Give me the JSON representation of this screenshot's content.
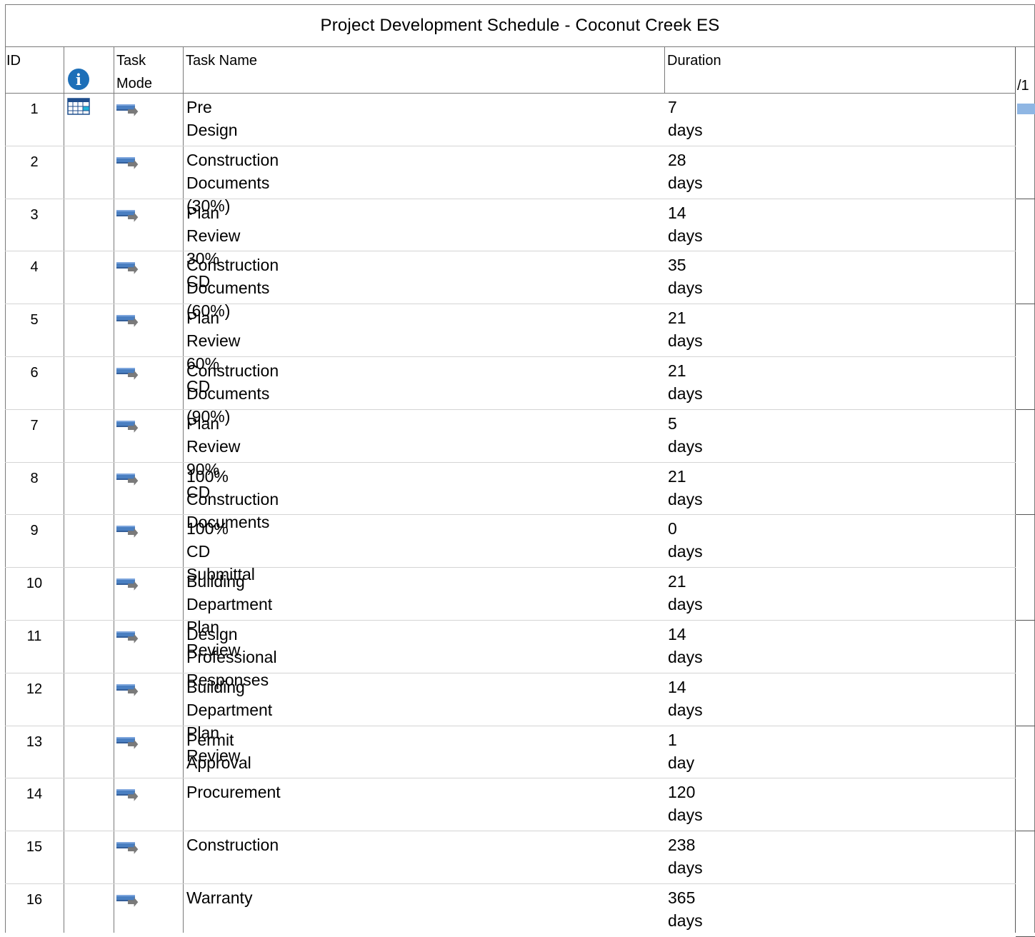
{
  "title": "Project Development Schedule - Coconut Creek ES",
  "columns": {
    "id": "ID",
    "indicators_icon": "info-icon",
    "task_mode_line1": "Task",
    "task_mode_line2": "Mode",
    "task_name": "Task Name",
    "duration": "Duration"
  },
  "gantt": {
    "timescale_label": "/1",
    "bar_color": "#8fb6e3"
  },
  "icons": {
    "info": "info-icon",
    "calendar": "calendar-icon",
    "task_mode": "auto-scheduled-task-icon"
  },
  "colors": {
    "info_icon": "#1d6fb8",
    "task_icon": "#4a7fc1"
  },
  "tasks": [
    {
      "id": "1",
      "name": "Pre Design",
      "duration": "7 days",
      "indicator": "calendar-icon"
    },
    {
      "id": "2",
      "name": "Construction Documents (30%)",
      "duration": "28 days"
    },
    {
      "id": "3",
      "name": "Plan Review 30% CD",
      "duration": "14 days"
    },
    {
      "id": "4",
      "name": "Construction Documents (60%)",
      "duration": "35 days"
    },
    {
      "id": "5",
      "name": "Plan Review 60% CD",
      "duration": "21 days"
    },
    {
      "id": "6",
      "name": "Construction Documents (90%)",
      "duration": "21 days"
    },
    {
      "id": "7",
      "name": "Plan Review 90% CD",
      "duration": "5 days"
    },
    {
      "id": "8",
      "name": "100% Construction Documents",
      "duration": "21 days"
    },
    {
      "id": "9",
      "name": "100% CD Submittal",
      "duration": "0 days"
    },
    {
      "id": "10",
      "name": "Building Department Plan Review",
      "duration": "21 days"
    },
    {
      "id": "11",
      "name": "Design Professional Responses",
      "duration": "14 days"
    },
    {
      "id": "12",
      "name": "Building Department Plan Review",
      "duration": "14 days"
    },
    {
      "id": "13",
      "name": "Permit Approval",
      "duration": "1 day"
    },
    {
      "id": "14",
      "name": "Procurement",
      "duration": "120 days"
    },
    {
      "id": "15",
      "name": "Construction",
      "duration": "238 days"
    },
    {
      "id": "16",
      "name": "Warranty",
      "duration": "365 days"
    }
  ]
}
